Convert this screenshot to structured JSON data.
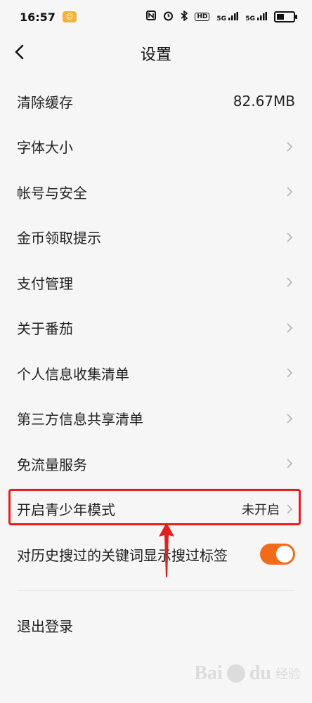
{
  "status_bar": {
    "time": "16:57",
    "icons": [
      "nfc-icon",
      "alarm-icon",
      "bluetooth-icon",
      "hd-icon",
      "signal-5g-icon",
      "signal-5g-icon",
      "battery-icon"
    ],
    "hd_text": "HD",
    "net1_text": "5G",
    "net2_text": "5G"
  },
  "header": {
    "title": "设置",
    "back_icon": "chevron-left-icon"
  },
  "settings": {
    "clear_cache": {
      "label": "清除缓存",
      "value": "82.67MB"
    },
    "font_size": {
      "label": "字体大小"
    },
    "account_security": {
      "label": "帐号与安全"
    },
    "coin_reminder": {
      "label": "金币领取提示"
    },
    "payment": {
      "label": "支付管理"
    },
    "about": {
      "label": "关于番茄"
    },
    "personal_info": {
      "label": "个人信息收集清单"
    },
    "third_party": {
      "label": "第三方信息共享清单"
    },
    "free_data": {
      "label": "免流量服务"
    },
    "teen_mode": {
      "label": "开启青少年模式",
      "value": "未开启"
    },
    "search_tags": {
      "label": "对历史搜过的关键词显示搜过标签",
      "toggle_on": true
    },
    "logout": {
      "label": "退出登录"
    }
  },
  "colors": {
    "accent": "#f46a1b",
    "highlight": "#e3201b",
    "background": "#f6f6f6"
  },
  "watermark": {
    "text_brand": "Bai",
    "text_brand2": "du",
    "text_jingyan": "经验"
  }
}
